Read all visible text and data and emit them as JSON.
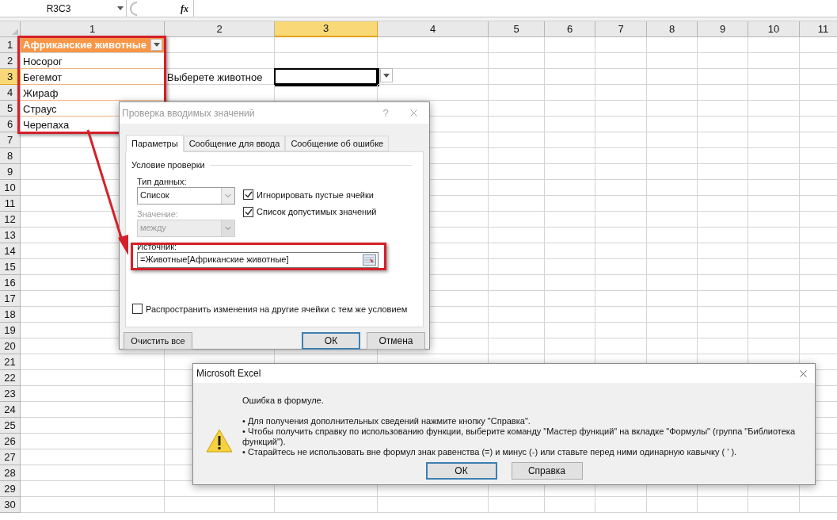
{
  "formula_bar": {
    "name_box": "R3C3",
    "function_button": "fx"
  },
  "columns": [
    {
      "label": "1",
      "selected": false
    },
    {
      "label": "2",
      "selected": false
    },
    {
      "label": "3",
      "selected": true
    },
    {
      "label": "4",
      "selected": false
    },
    {
      "label": "5",
      "selected": false
    },
    {
      "label": "6",
      "selected": false
    },
    {
      "label": "7",
      "selected": false
    },
    {
      "label": "8",
      "selected": false
    },
    {
      "label": "9",
      "selected": false
    },
    {
      "label": "10",
      "selected": false
    },
    {
      "label": "11",
      "selected": false
    }
  ],
  "rows": [
    {
      "label": "1",
      "selected": false,
      "column_1": {
        "kind": "table_header",
        "text": "Африканские животные"
      }
    },
    {
      "label": "2",
      "selected": false,
      "column_1": {
        "kind": "table_item",
        "text": "Носорог"
      }
    },
    {
      "label": "3",
      "selected": true,
      "column_1": {
        "kind": "table_item",
        "text": "Бегемот"
      },
      "column_2": {
        "kind": "text",
        "text": "Выберете животное"
      },
      "column_3": {
        "kind": "active",
        "dropdown": true
      }
    },
    {
      "label": "4",
      "selected": false,
      "column_1": {
        "kind": "table_item",
        "text": "Жираф"
      }
    },
    {
      "label": "5",
      "selected": false,
      "column_1": {
        "kind": "table_item",
        "text": "Страус"
      }
    },
    {
      "label": "6",
      "selected": false,
      "column_1": {
        "kind": "table_item",
        "text": "Черепаха"
      }
    },
    {
      "label": "7",
      "selected": false
    },
    {
      "label": "8",
      "selected": false
    },
    {
      "label": "9",
      "selected": false
    },
    {
      "label": "10",
      "selected": false
    },
    {
      "label": "11",
      "selected": false
    },
    {
      "label": "12",
      "selected": false
    },
    {
      "label": "13",
      "selected": false
    },
    {
      "label": "14",
      "selected": false
    },
    {
      "label": "15",
      "selected": false
    },
    {
      "label": "16",
      "selected": false
    },
    {
      "label": "17",
      "selected": false
    },
    {
      "label": "18",
      "selected": false
    },
    {
      "label": "19",
      "selected": false
    },
    {
      "label": "20",
      "selected": false
    },
    {
      "label": "21",
      "selected": false
    },
    {
      "label": "22",
      "selected": false
    },
    {
      "label": "23",
      "selected": false
    },
    {
      "label": "24",
      "selected": false
    },
    {
      "label": "25",
      "selected": false
    },
    {
      "label": "26",
      "selected": false
    },
    {
      "label": "27",
      "selected": false
    },
    {
      "label": "28",
      "selected": false
    },
    {
      "label": "29",
      "selected": false
    },
    {
      "label": "30",
      "selected": false
    }
  ],
  "validation_dialog": {
    "title": "Проверка вводимых значений",
    "help_button": "?",
    "tabs": [
      {
        "label": "Параметры",
        "selected": true
      },
      {
        "label": "Сообщение для ввода",
        "selected": false
      },
      {
        "label": "Сообщение об ошибке",
        "selected": false
      }
    ],
    "group_title": "Условие проверки",
    "selects": [
      {
        "label": "Тип данных:",
        "value": "Список",
        "disabled": false
      },
      {
        "label": "Значение:",
        "value": "между",
        "disabled": true
      }
    ],
    "checkboxes": [
      {
        "label": "Игнорировать пустые ячейки",
        "checked": true
      },
      {
        "label": "Список допустимых значений",
        "checked": true
      }
    ],
    "source": {
      "label": "Источник:",
      "value": "=Животные[Африканские животные]"
    },
    "propagate": {
      "label": "Распространить изменения на другие ячейки с тем же условием",
      "checked": false
    },
    "clear_button": "Очистить все",
    "buttons": [
      {
        "label": "ОК",
        "default": true
      },
      {
        "label": "Отмена",
        "default": false
      }
    ]
  },
  "error_dialog": {
    "title": "Microsoft Excel",
    "heading": "Ошибка в формуле.",
    "bullets": [
      "• Для получения дополнительных сведений нажмите кнопку \"Справка\".",
      "• Чтобы получить справку по использованию функции, выберите команду \"Мастер функций\" на вкладке \"Формулы\" (группа \"Библиотека функций\").",
      "• Старайтесь не использовать вне формул знак равенства (=) и минус (-) или ставьте перед ними одинарную кавычку ( ' )."
    ],
    "buttons": [
      {
        "label": "ОК",
        "default": true
      },
      {
        "label": "Справка",
        "default": false
      }
    ]
  }
}
